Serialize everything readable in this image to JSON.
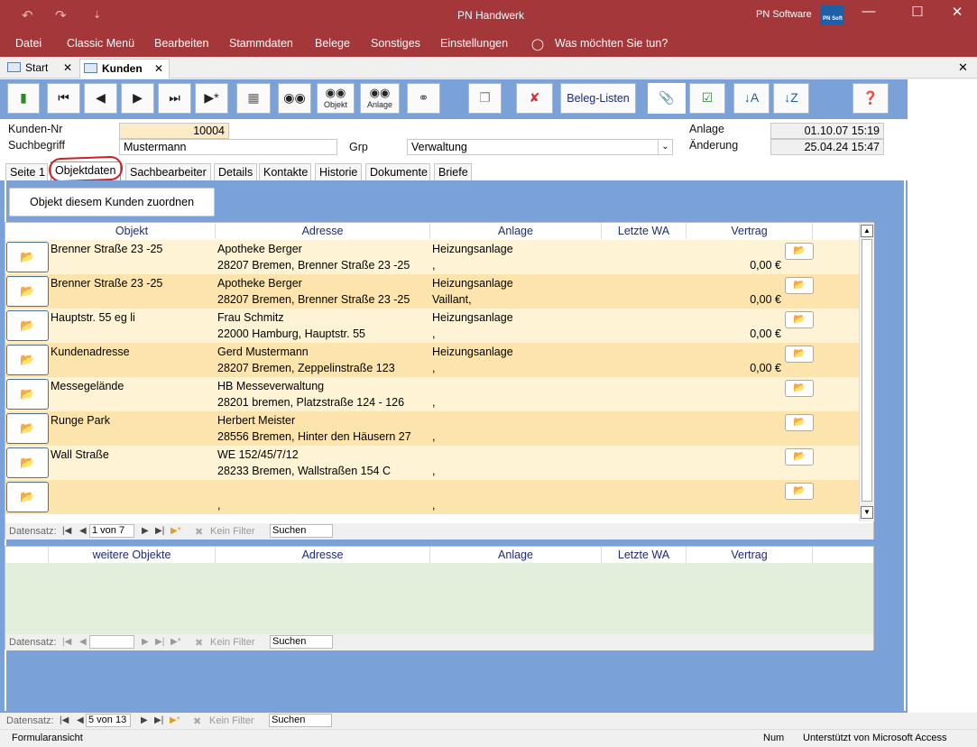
{
  "app": {
    "title": "PN Handwerk",
    "brand": "PN Software",
    "logo_text": "PN Soft"
  },
  "quick_access": {
    "undo": "↶",
    "redo": "↷",
    "more": "⇣"
  },
  "window_controls": {
    "minimize": "—",
    "maximize": "☐",
    "close": "✕"
  },
  "menu": [
    "Datei",
    "Classic Menü",
    "Bearbeiten",
    "Stammdaten",
    "Belege",
    "Sonstiges",
    "Einstellungen"
  ],
  "tell_me": "Was möchten Sie tun?",
  "doc_tabs": [
    {
      "label": "Start"
    },
    {
      "label": "Kunden"
    }
  ],
  "doc_tab_close": "✕",
  "toolbar": {
    "objekt_label": "Objekt",
    "anlage_label": "Anlage",
    "beleg_listen": "Beleg-Listen"
  },
  "header": {
    "kunden_nr_label": "Kunden-Nr",
    "kunden_nr": "10004",
    "suchbegriff_label": "Suchbegriff",
    "suchbegriff": "Mustermann",
    "grp_label": "Grp",
    "grp": "Verwaltung",
    "anlage_label": "Anlage",
    "anlage": "01.10.07 15:19",
    "aenderung_label": "Änderung",
    "aenderung": "25.04.24 15:47"
  },
  "subtabs": [
    "Seite 1",
    "Objektdaten",
    "Sachbearbeiter",
    "Details",
    "Kontakte",
    "Historie",
    "Dokumente",
    "Briefe"
  ],
  "assign_button": "Objekt diesem Kunden zuordnen",
  "grid1": {
    "columns": [
      "Objekt",
      "Adresse",
      "Anlage",
      "Letzte WA",
      "Vertrag"
    ],
    "rows": [
      {
        "objekt": "Brenner Straße 23 -25",
        "adr1": "Apotheke Berger",
        "adr2": "28207 Bremen, Brenner Straße 23 -25",
        "anl1": "Heizungsanlage",
        "anl2": ",",
        "vertrag": "0,00 €"
      },
      {
        "objekt": "Brenner Straße 23 -25",
        "adr1": "Apotheke Berger",
        "adr2": "28207 Bremen, Brenner Straße 23 -25",
        "anl1": "Heizungsanlage",
        "anl2": "Vaillant,",
        "vertrag": "0,00 €"
      },
      {
        "objekt": "Hauptstr. 55 eg li",
        "adr1": "Frau Schmitz",
        "adr2": "22000 Hamburg, Hauptstr. 55",
        "anl1": "Heizungsanlage",
        "anl2": ",",
        "vertrag": "0,00 €"
      },
      {
        "objekt": "Kundenadresse",
        "adr1": "Gerd Mustermann",
        "adr2": "28207 Bremen, Zeppelinstraße 123",
        "anl1": "Heizungsanlage",
        "anl2": ",",
        "vertrag": "0,00 €"
      },
      {
        "objekt": "Messegelände",
        "adr1": "HB Messeverwaltung",
        "adr2": "28201 bremen, Platzstraße 124 - 126",
        "anl1": "",
        "anl2": ",",
        "vertrag": ""
      },
      {
        "objekt": "Runge Park",
        "adr1": "Herbert Meister",
        "adr2": "28556 Bremen, Hinter den Häusern 27",
        "anl1": "",
        "anl2": ",",
        "vertrag": ""
      },
      {
        "objekt": "Wall Straße",
        "adr1": "WE 152/45/7/12",
        "adr2": "28233 Bremen, Wallstraßen 154 C",
        "anl1": "",
        "anl2": ",",
        "vertrag": ""
      },
      {
        "objekt": "",
        "adr1": "",
        "adr2": " ,",
        "anl1": "",
        "anl2": ",",
        "vertrag": ""
      }
    ],
    "nav": {
      "label": "Datensatz:",
      "position": "1 von 7",
      "filter": "Kein Filter",
      "search": "Suchen"
    }
  },
  "grid2": {
    "columns": [
      "weitere Objekte",
      "Adresse",
      "Anlage",
      "Letzte WA",
      "Vertrag"
    ],
    "nav": {
      "label": "Datensatz:",
      "position": "",
      "filter": "Kein Filter",
      "search": "Suchen"
    }
  },
  "main_nav": {
    "label": "Datensatz:",
    "position": "5 von 13",
    "filter": "Kein Filter",
    "search": "Suchen"
  },
  "status": {
    "view": "Formularansicht",
    "num": "Num",
    "powered": "Unterstützt von Microsoft Access"
  }
}
